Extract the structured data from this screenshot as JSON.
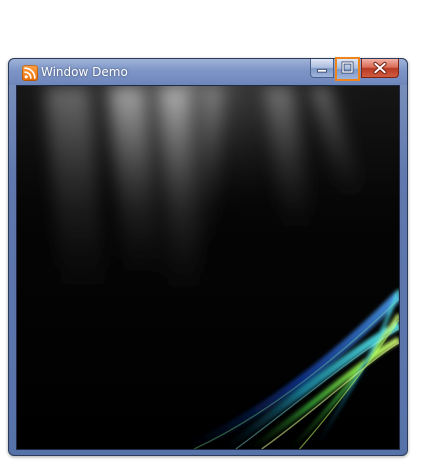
{
  "window": {
    "title": "Window Demo",
    "app_icon": "rss-feed-icon",
    "controls": {
      "minimize_icon": "minimize-icon",
      "maximize_icon": "maximize-icon",
      "close_icon": "close-icon"
    },
    "focused_control": "maximize"
  },
  "content": {
    "background_image": "aurora-wallpaper",
    "colors": {
      "accent_orange": "#f0851c",
      "titlebar_blue": "#6e87bb",
      "close_red": "#b73b25",
      "background": "#000000"
    }
  }
}
